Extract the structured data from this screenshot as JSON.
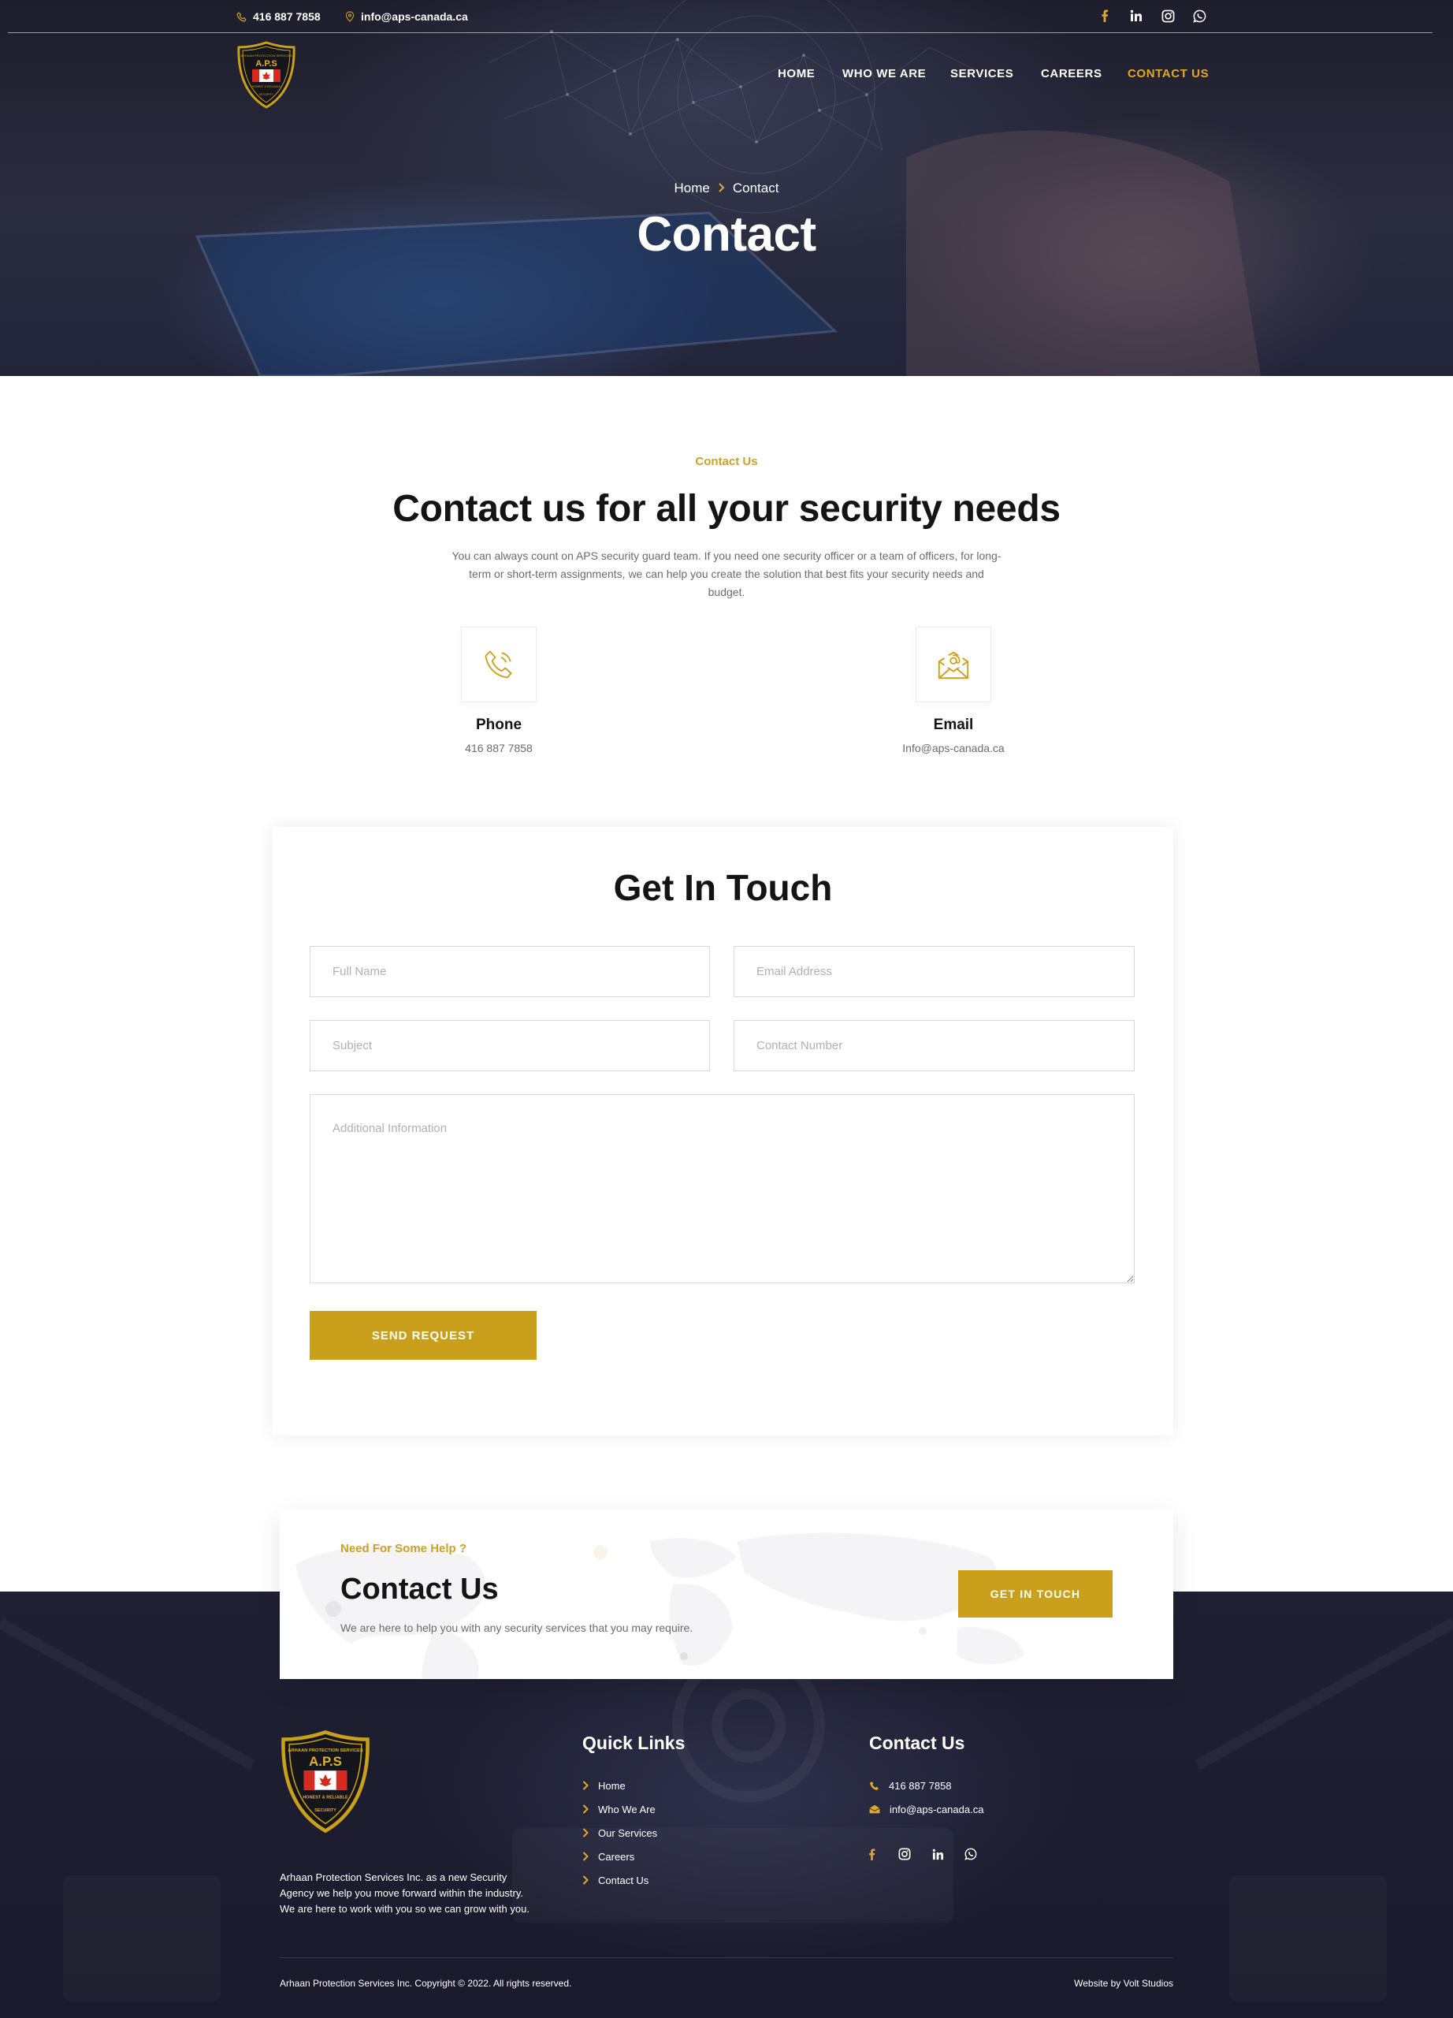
{
  "colors": {
    "accent": "#c9a01c",
    "accent_light": "#e0a92a",
    "dark": "#1f2033",
    "text": "#141414",
    "muted": "#6a6a6a"
  },
  "topbar": {
    "phone": "416 887 7858",
    "email": "info@aps-canada.ca",
    "social_icons": [
      "facebook-icon",
      "linkedin-icon",
      "instagram-icon",
      "whatsapp-icon"
    ]
  },
  "logo": {
    "top_text": "ARHAAN PROTECTION SERVICES",
    "name": "A.P.S",
    "motto": "HONEST & RELIABLE",
    "bottom_text": "SECURITY"
  },
  "nav": {
    "items": [
      {
        "label": "HOME"
      },
      {
        "label": "WHO WE ARE"
      },
      {
        "label": "SERVICES"
      },
      {
        "label": "CAREERS"
      },
      {
        "label": "CONTACT US",
        "active": true
      }
    ]
  },
  "hero": {
    "breadcrumb_home": "Home",
    "breadcrumb_current": "Contact",
    "title": "Contact"
  },
  "intro": {
    "eyebrow": "Contact Us",
    "title": "Contact us for all your security needs",
    "text": "You can always count on APS security guard team. If you need one security officer or a team of officers, for long-term or short-term assignments, we can help you create the solution that best fits your security needs and budget.",
    "phone_label": "Phone",
    "phone_value": "416 887 7858",
    "email_label": "Email",
    "email_value": "Info@aps-canada.ca"
  },
  "form": {
    "title": "Get In Touch",
    "full_name_placeholder": "Full Name",
    "email_placeholder": "Email Address",
    "subject_placeholder": "Subject",
    "contact_number_placeholder": "Contact Number",
    "info_placeholder": "Additional Information",
    "submit_label": "SEND REQUEST"
  },
  "cta": {
    "eyebrow": "Need For Some Help ?",
    "title": "Contact Us",
    "text": "We are here to help you with any security services that you may require.",
    "button_label": "GET IN TOUCH"
  },
  "footer": {
    "about": "Arhaan Protection Services Inc. as a new Security Agency we help you move forward within the industry. We are here to work with you so we can grow with you.",
    "quick_links_title": "Quick Links",
    "quick_links": [
      {
        "label": "Home"
      },
      {
        "label": "Who We Are"
      },
      {
        "label": "Our Services"
      },
      {
        "label": "Careers"
      },
      {
        "label": "Contact Us"
      }
    ],
    "contact_title": "Contact Us",
    "phone": "416 887 7858",
    "email": "info@aps-canada.ca",
    "social_icons": [
      "facebook-icon",
      "instagram-icon",
      "linkedin-icon",
      "whatsapp-icon"
    ],
    "copyright": "Arhaan Protection Services Inc. Copyright © 2022. All rights reserved.",
    "credit": "Website by Volt Studios"
  }
}
